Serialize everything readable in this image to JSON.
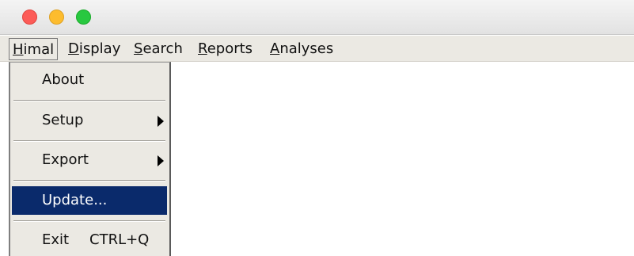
{
  "window": {
    "controls": [
      "close-icon",
      "minimize-icon",
      "maximize-icon"
    ],
    "colors": {
      "close": "#fc5b57",
      "minimize": "#fdbc2e",
      "maximize": "#28c840"
    }
  },
  "menubar": {
    "items": [
      {
        "mnemonic": "H",
        "rest": "imal"
      },
      {
        "mnemonic": "D",
        "rest": "isplay"
      },
      {
        "mnemonic": "S",
        "rest": "earch"
      },
      {
        "mnemonic": "R",
        "rest": "eports"
      },
      {
        "mnemonic": "A",
        "rest": "nalyses"
      }
    ]
  },
  "dropdown": {
    "items": [
      {
        "label": "About"
      },
      {
        "label": "Setup",
        "submenu": true
      },
      {
        "label": "Export",
        "submenu": true
      },
      {
        "label": "Update...",
        "selected": true
      },
      {
        "label": "Exit",
        "shortcut": "CTRL+Q"
      }
    ],
    "selected_color": "#0a2a6b"
  }
}
